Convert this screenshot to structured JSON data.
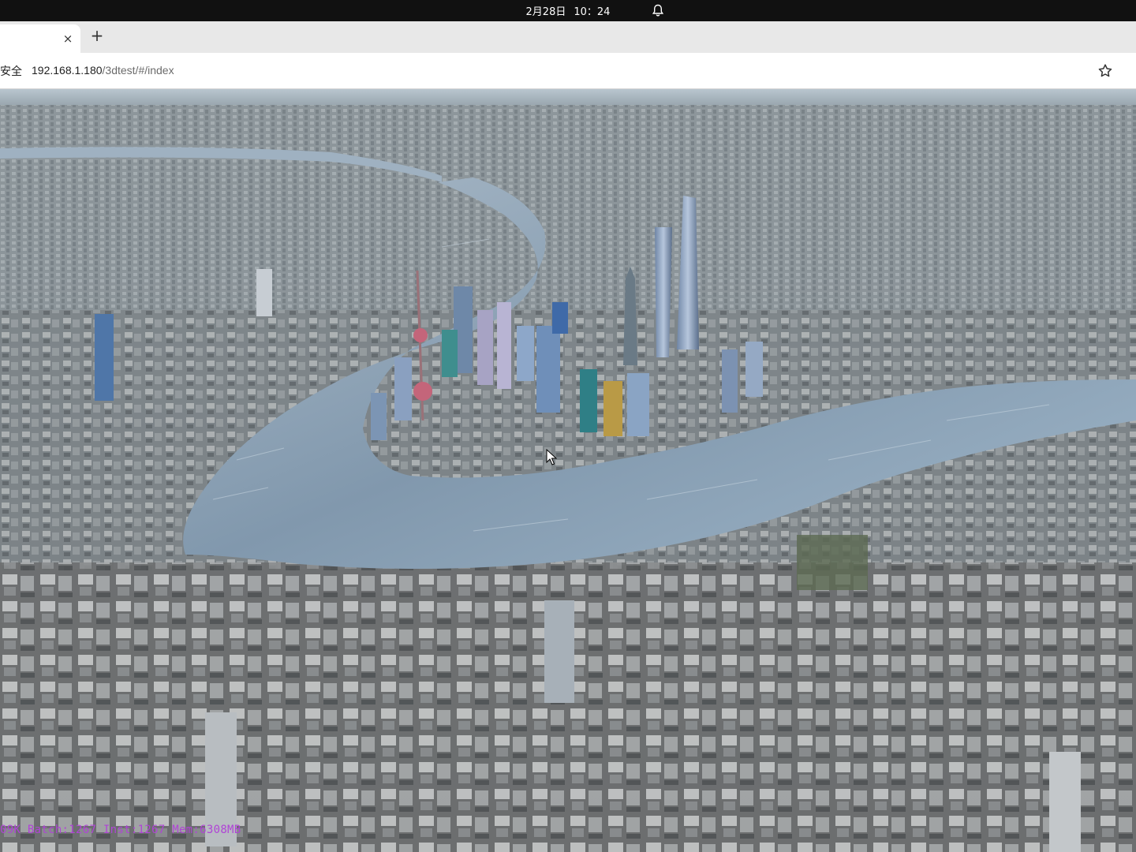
{
  "os": {
    "date": "2月28日",
    "time": "10：24",
    "notification_icon": "bell-icon"
  },
  "browser": {
    "tab": {
      "close_symbol": "×"
    },
    "new_tab_symbol": "+",
    "security_label": "安全",
    "url_host": "192.168.1.180",
    "url_path": "/3dtest/#/index",
    "bookmark_icon": "star-icon"
  },
  "viewer": {
    "stats_text": "09K Batch:1267 Inst:1267 Mem:6308MB"
  },
  "colors": {
    "os_bar": "#111111",
    "tab_strip": "#e8e8e8",
    "river": "#8fa3b6",
    "stats": "#b044d6"
  }
}
